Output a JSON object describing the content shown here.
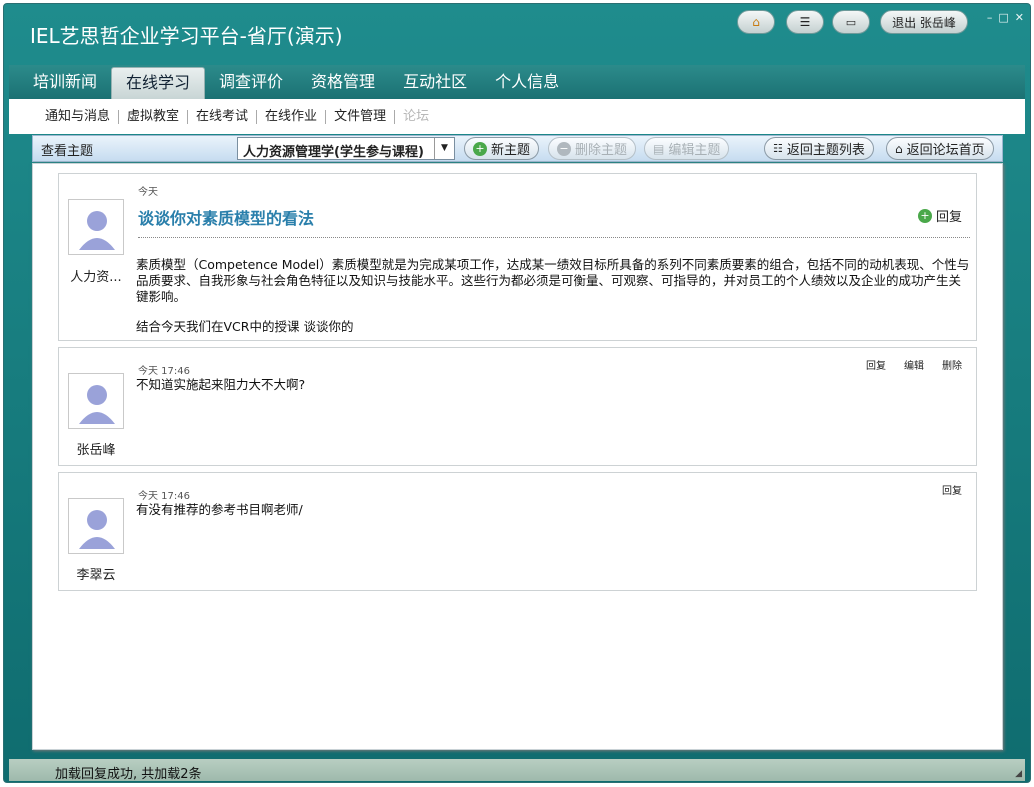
{
  "app": {
    "title": "IEL艺思哲企业学习平台-省厅(演示)",
    "logout_label": "退出 张岳峰",
    "win_min": "–",
    "win_max": "□",
    "win_close": "✕"
  },
  "nav": {
    "tabs": [
      "培训新闻",
      "在线学习",
      "调查评价",
      "资格管理",
      "互动社区",
      "个人信息"
    ],
    "active_index": 1
  },
  "subnav": {
    "items": [
      "通知与消息",
      "虚拟教室",
      "在线考试",
      "在线作业",
      "文件管理",
      "论坛"
    ]
  },
  "toolbar": {
    "label": "查看主题",
    "course": "人力资源管理学(学生参与课程)",
    "new_topic": "新主题",
    "delete_topic": "删除主题",
    "edit_topic": "编辑主题",
    "back_list": "返回主题列表",
    "back_home": "返回论坛首页"
  },
  "posts": [
    {
      "user": "人力资...",
      "time": "今天",
      "title": "谈谈你对素质模型的看法",
      "reply": "回复",
      "body": "素质模型（Competence Model）素质模型就是为完成某项工作，达成某一绩效目标所具备的系列不同素质要素的组合，包括不同的动机表现、个性与品质要求、自我形象与社会角色特征以及知识与技能水平。这些行为都必须是可衡量、可观察、可指导的，并对员工的个人绩效以及企业的成功产生关键影响。",
      "body2": "结合今天我们在VCR中的授课 谈谈你的"
    },
    {
      "user": "张岳峰",
      "time": "今天 17:46",
      "body": "不知道实施起来阻力大不大啊?",
      "actions": [
        "回复",
        "编辑",
        "删除"
      ]
    },
    {
      "user": "李翠云",
      "time": "今天 17:46",
      "body": "有没有推荐的参考书目啊老师/",
      "actions": [
        "回复"
      ]
    }
  ],
  "status": {
    "text": "加载回复成功, 共加载2条"
  },
  "colors": {
    "titlebar": "#1a7d7f",
    "link": "#2a7fab",
    "status_bar": "#a9c3b6"
  }
}
